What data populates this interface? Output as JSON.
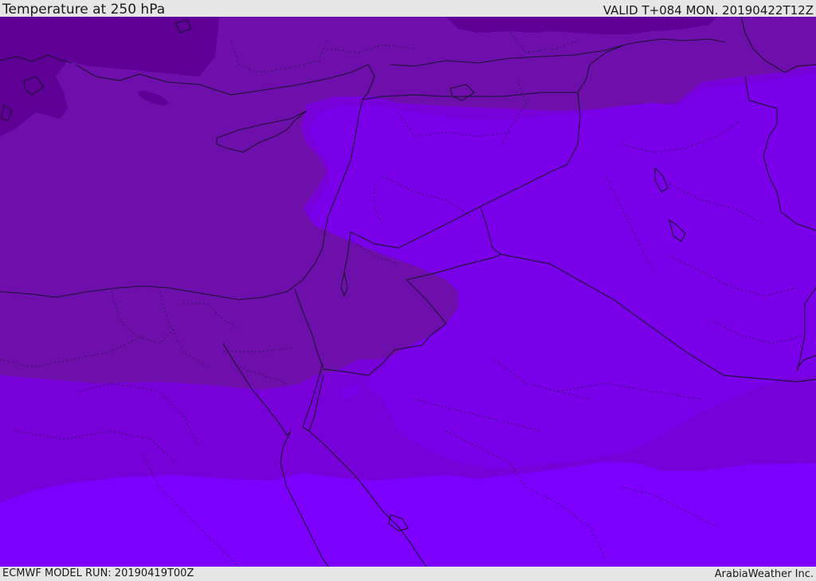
{
  "header": {
    "title": "Temperature at 250 hPa",
    "valid_time": "VALID T+084 MON. 20190422T12Z"
  },
  "footer": {
    "model_run": "ECMWF MODEL RUN: 20190419T00Z",
    "credit": "ArabiaWeather Inc."
  },
  "map": {
    "field": "temperature",
    "level": "250 hPa",
    "region": "Eastern Mediterranean / Middle East",
    "colors": {
      "band_coldest": "#5e0096",
      "band_cold": "#6e0fac",
      "band_mid": "#7800d8",
      "band_warm": "#7a00ea",
      "band_warmest": "#7d00ff",
      "coastline": "#1c1230",
      "border": "#221440",
      "internal_border": "#2a1850"
    }
  }
}
